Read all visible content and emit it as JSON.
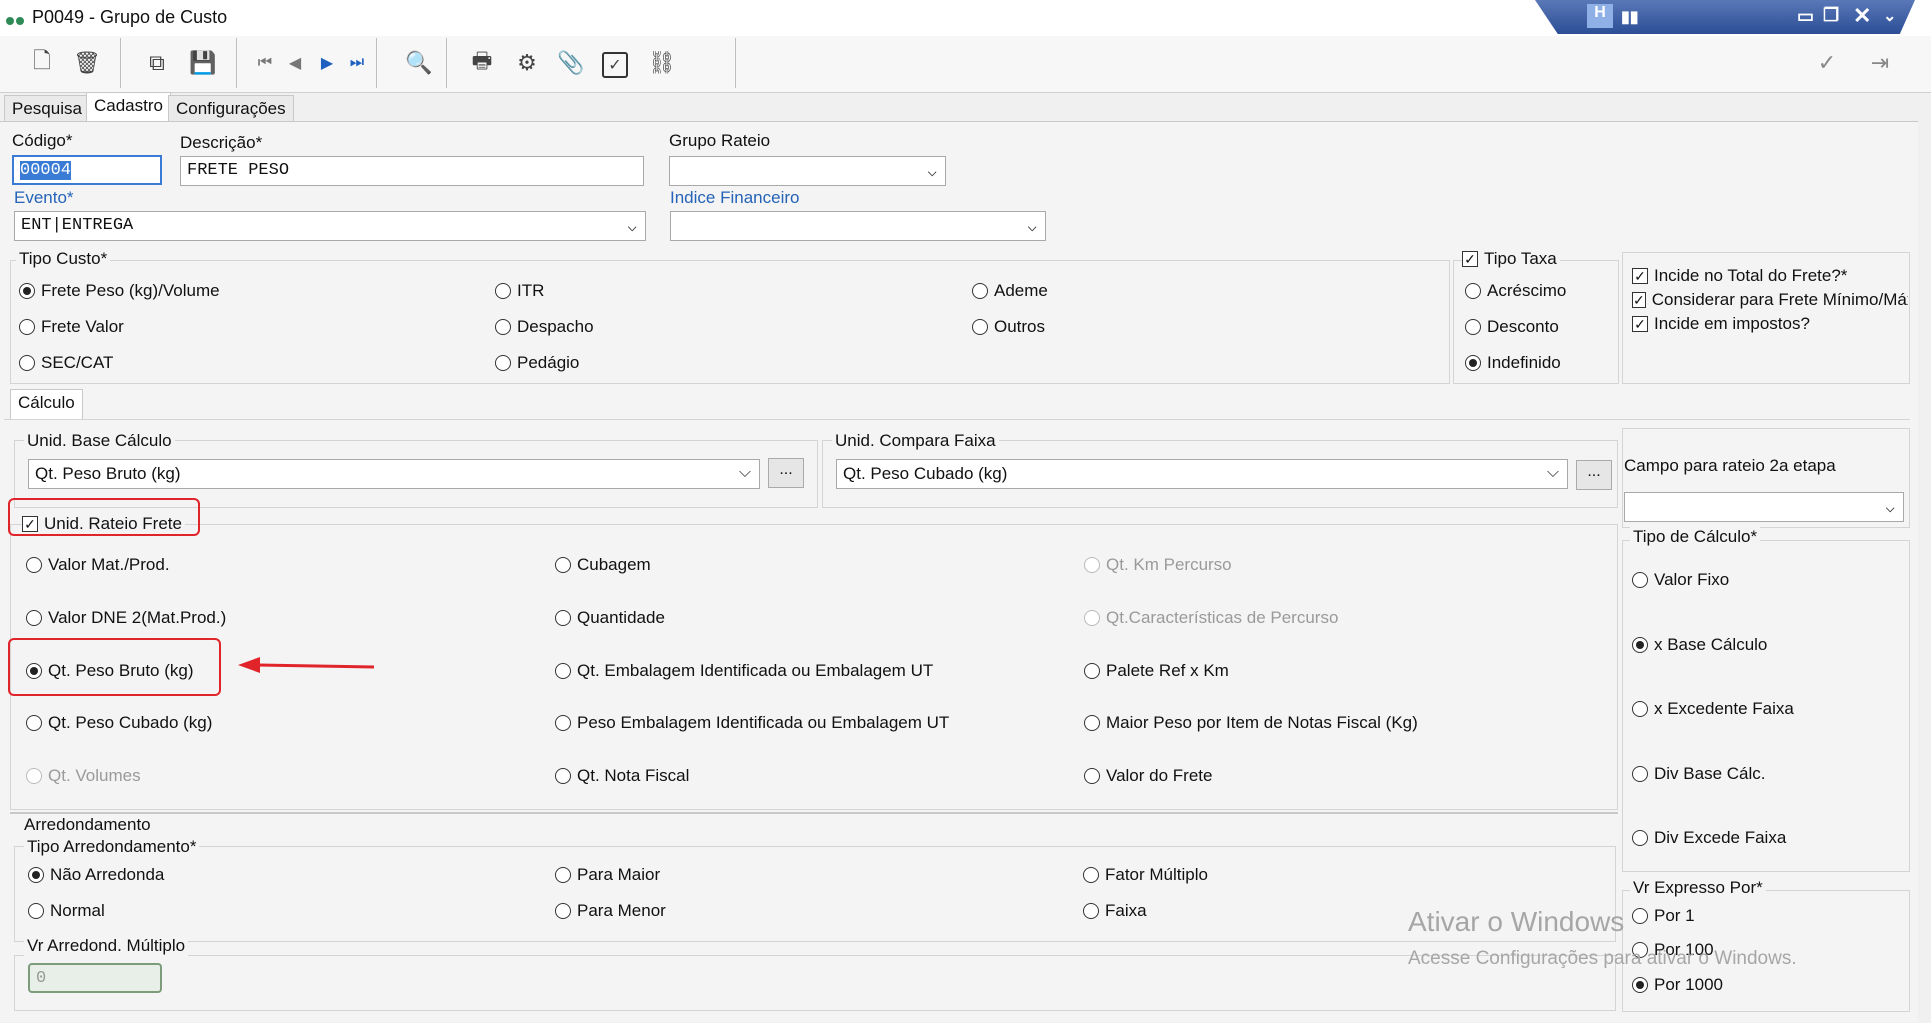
{
  "window": {
    "title": "P0049 - Grupo de Custo"
  },
  "tabs": [
    "Pesquisa",
    "Cadastro",
    "Configurações"
  ],
  "fields": {
    "codigo": {
      "label": "Código*",
      "value": "00004"
    },
    "descricao": {
      "label": "Descrição*",
      "value": "FRETE PESO"
    },
    "grupo_rateio": {
      "label": "Grupo Rateio",
      "value": ""
    },
    "evento": {
      "label": "Evento*",
      "value": "ENT|ENTREGA"
    },
    "indice_financeiro": {
      "label": "Indice Financeiro",
      "value": ""
    }
  },
  "tipo_custo": {
    "legend": "Tipo Custo*",
    "options": [
      "Frete Peso (kg)/Volume",
      "ITR",
      "Ademe",
      "Frete Valor",
      "Despacho",
      "Outros",
      "SEC/CAT",
      "Pedágio"
    ],
    "selected": "Frete Peso (kg)/Volume"
  },
  "tipo_taxa": {
    "legend": "Tipo Taxa",
    "options": [
      "Acréscimo",
      "Desconto",
      "Indefinido"
    ],
    "selected": "Indefinido"
  },
  "flags": [
    "Incide no Total do Frete?*",
    "Considerar para Frete Mínimo/Máxir",
    "Incide em impostos?"
  ],
  "calc_tab": "Cálculo",
  "unid_base": {
    "legend": "Unid. Base Cálculo",
    "value": "Qt. Peso Bruto (kg)"
  },
  "unid_compara": {
    "legend": "Unid. Compara Faixa",
    "value": "Qt. Peso Cubado (kg)"
  },
  "ellipsis": "...",
  "campo_rateio": {
    "label": "Campo para rateio 2a etapa",
    "value": ""
  },
  "unid_rateio": {
    "label": "Unid. Rateio Frete",
    "options": [
      "Valor Mat./Prod.",
      "Cubagem",
      "Qt. Km Percurso",
      "Valor DNE 2(Mat.Prod.)",
      "Quantidade",
      "Qt.Características de Percurso",
      "Qt. Peso Bruto (kg)",
      "Qt. Embalagem Identificada ou Embalagem UT",
      "Palete Ref x Km",
      "Qt. Peso Cubado (kg)",
      "Peso Embalagem Identificada ou Embalagem UT",
      "Maior Peso por Item de Notas Fiscal (Kg)",
      "Qt. Volumes",
      "Qt. Nota Fiscal",
      "Valor do Frete"
    ],
    "selected": "Qt. Peso Bruto (kg)"
  },
  "tipo_calculo": {
    "legend": "Tipo de Cálculo*",
    "options": [
      "Valor Fixo",
      "x Base Cálculo",
      "x Excedente Faixa",
      "Div Base Cálc.",
      "Div Excede Faixa"
    ],
    "selected": "x Base Cálculo"
  },
  "arredondamento": {
    "title": "Arredondamento",
    "legend": "Tipo Arredondamento*",
    "options": [
      "Não Arredonda",
      "Para Maior",
      "Fator Múltiplo",
      "Normal",
      "Para Menor",
      "Faixa"
    ],
    "selected": "Não Arredonda",
    "multiplo_label": "Vr Arredond. Múltiplo",
    "multiplo_value": "0"
  },
  "vr_expresso": {
    "legend": "Vr Expresso Por*",
    "options": [
      "Por 1",
      "Por 100",
      "Por 1000"
    ],
    "selected": "Por 1000"
  },
  "watermark": {
    "line1": "Ativar o Windows",
    "line2": "Acesse Configurações para ativar o Windows."
  },
  "colors": {
    "annotation": "#e0242a",
    "link_label": "#2563b8"
  }
}
